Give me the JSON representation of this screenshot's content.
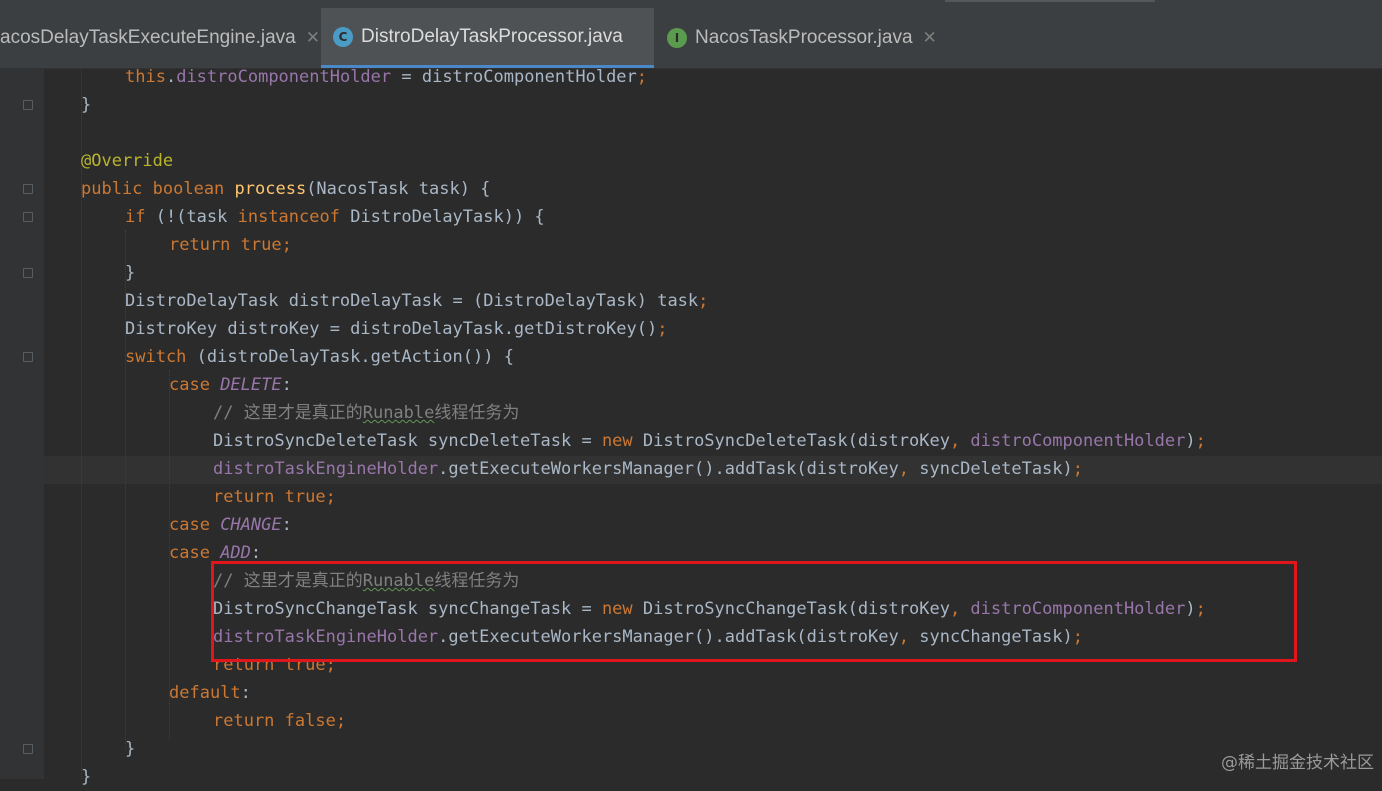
{
  "tabs": [
    {
      "label": "acosDelayTaskExecuteEngine.java",
      "icon": "",
      "active": false
    },
    {
      "label": "DistroDelayTaskProcessor.java",
      "icon": "C",
      "active": true
    },
    {
      "label": "NacosTaskProcessor.java",
      "icon": "I",
      "active": false
    }
  ],
  "colors": {
    "keyword": "#cc7832",
    "field": "#9876aa",
    "method": "#ffc66d",
    "annotation": "#bbb529",
    "comment": "#808080",
    "highlight_box": "#e0161c",
    "class_icon": "#4a9bc6",
    "interface_icon": "#5a9b4e"
  },
  "code": {
    "l1": {
      "t1": "this",
      "t2": ".",
      "t3": "distroComponentHolder",
      "t4": " = distroComponentHolder",
      "t5": ";"
    },
    "l2": {
      "t1": "}"
    },
    "l3": {
      "t1": "@Override"
    },
    "l4": {
      "t1": "public boolean ",
      "t2": "process",
      "t3": "(NacosTask task) {"
    },
    "l5": {
      "t1": "if ",
      "t2": "(!(task ",
      "t3": "instanceof ",
      "t4": "DistroDelayTask)) {"
    },
    "l6": {
      "t1": "return true",
      "t2": ";"
    },
    "l7": {
      "t1": "}"
    },
    "l8": {
      "t1": "DistroDelayTask distroDelayTask = (DistroDelayTask) task",
      "t2": ";"
    },
    "l9": {
      "t1": "DistroKey distroKey = distroDelayTask.getDistroKey()",
      "t2": ";"
    },
    "l10": {
      "t1": "switch ",
      "t2": "(distroDelayTask.getAction()) {"
    },
    "l11": {
      "t1": "case ",
      "t2": "DELETE",
      "t3": ":"
    },
    "l12": {
      "t1": "// 这里才是真正的",
      "t2": "Runable",
      "t3": "线程任务为"
    },
    "l13": {
      "t1": "DistroSyncDeleteTask syncDeleteTask = ",
      "t2": "new ",
      "t3": "DistroSyncDeleteTask(distroKey",
      "t4": ", ",
      "t5": "distroComponentHolder",
      "t6": ")",
      "t7": ";"
    },
    "l14": {
      "t1": "distroTaskEngineHolder",
      "t2": ".getExecuteWorkersManager().addTask(distroKey",
      "t3": ", ",
      "t4": "syncDeleteTask)",
      "t5": ";"
    },
    "l15": {
      "t1": "return true",
      "t2": ";"
    },
    "l16": {
      "t1": "case ",
      "t2": "CHANGE",
      "t3": ":"
    },
    "l17": {
      "t1": "case ",
      "t2": "ADD",
      "t3": ":"
    },
    "l18": {
      "t1": "// 这里才是真正的",
      "t2": "Runable",
      "t3": "线程任务为"
    },
    "l19": {
      "t1": "DistroSyncChangeTask syncChangeTask = ",
      "t2": "new ",
      "t3": "DistroSyncChangeTask(distroKey",
      "t4": ", ",
      "t5": "distroComponentHolder",
      "t6": ")",
      "t7": ";"
    },
    "l20": {
      "t1": "distroTaskEngineHolder",
      "t2": ".getExecuteWorkersManager().addTask(distroKey",
      "t3": ", ",
      "t4": "syncChangeTask)",
      "t5": ";"
    },
    "l21": {
      "t1": "return true",
      "t2": ";"
    },
    "l22": {
      "t1": "default",
      "t2": ":"
    },
    "l23": {
      "t1": "return false",
      "t2": ";"
    },
    "l24": {
      "t1": "}"
    },
    "l25": {
      "t1": "}"
    }
  },
  "watermark": "@稀土掘金技术社区"
}
